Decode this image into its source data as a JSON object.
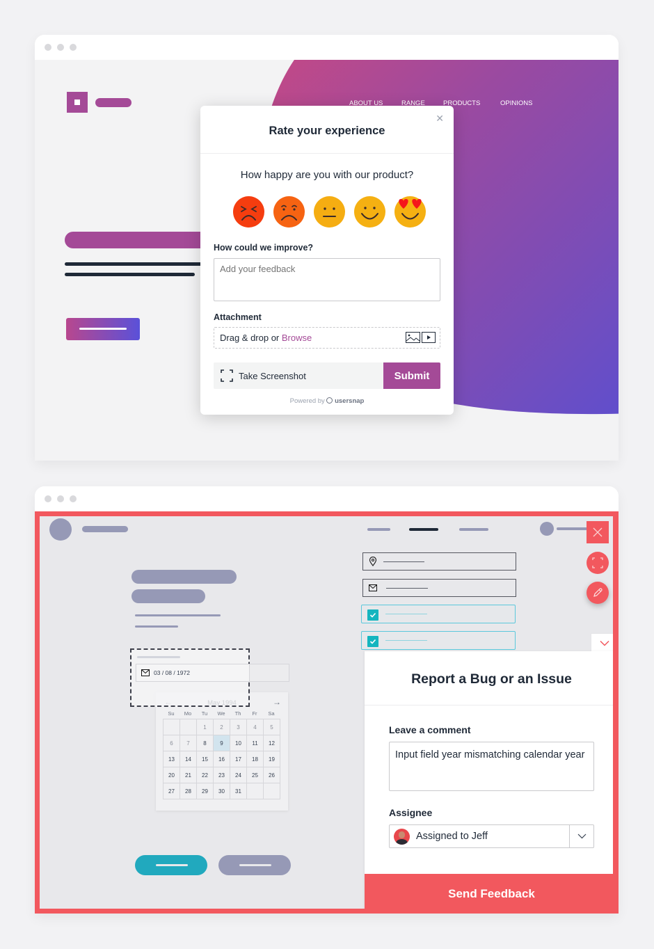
{
  "rating_demo": {
    "nav": [
      "ABOUT US",
      "RANGE",
      "PRODUCTS",
      "OPINIONS"
    ],
    "modal": {
      "title": "Rate your experience",
      "close_icon": "close-icon",
      "question": "How happy are you with our product?",
      "ratings": [
        {
          "name": "angry",
          "color": "#f53d0f"
        },
        {
          "name": "sad",
          "color": "#f66312"
        },
        {
          "name": "neutral",
          "color": "#f5ad12"
        },
        {
          "name": "happy",
          "color": "#f5b012"
        },
        {
          "name": "love",
          "color": "#f5b012"
        }
      ],
      "improve_label": "How could we improve?",
      "feedback_placeholder": "Add your feedback",
      "feedback_value": "",
      "attachment_label": "Attachment",
      "drop_text": "Drag & drop or ",
      "browse_link": "Browse",
      "screenshot_label": "Take Screenshot",
      "submit_label": "Submit",
      "powered_prefix": "Powered by",
      "powered_brand": "usersnap",
      "accent": "#a44a97"
    }
  },
  "bug_demo": {
    "date_field_value": "03 / 08 / 1972",
    "calendar": {
      "title": "May 1994",
      "weekdays": [
        "Su",
        "Mo",
        "Tu",
        "We",
        "Th",
        "Fr",
        "Sa"
      ],
      "days": [
        "",
        "",
        "1",
        "2",
        "3",
        "4",
        "5",
        "6",
        "7",
        "8",
        "9",
        "10",
        "11",
        "12",
        "13",
        "14",
        "15",
        "16",
        "17",
        "18",
        "19",
        "20",
        "21",
        "22",
        "23",
        "24",
        "25",
        "26",
        "27",
        "28",
        "29",
        "30",
        "31",
        "",
        ""
      ],
      "selected": "9"
    },
    "panel": {
      "title": "Report a Bug or an Issue",
      "comment_label": "Leave a comment",
      "comment_value": "Input field year mismatching calendar year",
      "assignee_label": "Assignee",
      "assignee_value": "Assigned to Jeff",
      "send_label": "Send Feedback",
      "accent": "#f2585e"
    }
  }
}
